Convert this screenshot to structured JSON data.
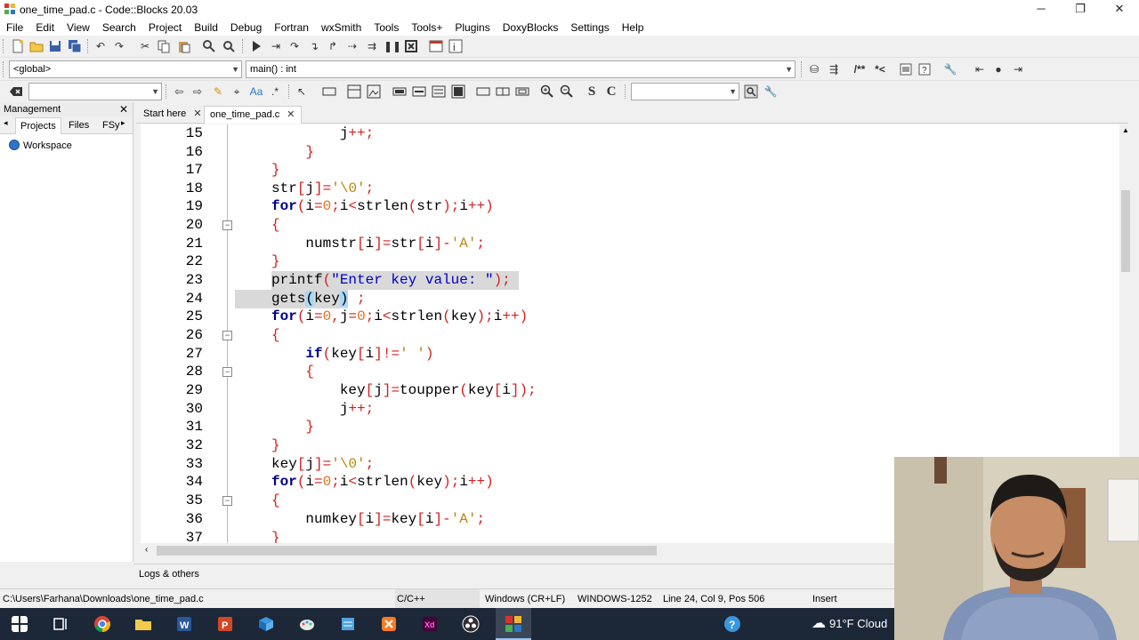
{
  "window": {
    "title": "one_time_pad.c - Code::Blocks 20.03",
    "minimize": "─",
    "restore": "❐",
    "close": "✕"
  },
  "menu": [
    "File",
    "Edit",
    "View",
    "Search",
    "Project",
    "Build",
    "Debug",
    "Fortran",
    "wxSmith",
    "Tools",
    "Tools+",
    "Plugins",
    "DoxyBlocks",
    "Settings",
    "Help"
  ],
  "code_toolbar": {
    "scope": "<global>",
    "function": "main() : int",
    "search": "",
    "doc_search": ""
  },
  "toolbar_text": {
    "comment_block": "/**",
    "comment_line": "*<",
    "sym_s": "S",
    "sym_c": "C"
  },
  "management": {
    "title": "Management",
    "close": "✕",
    "tabs": [
      "Projects",
      "Files",
      "FSy"
    ],
    "tree_root": "Workspace"
  },
  "editor_tabs": [
    {
      "label": "Start here",
      "close": "✕"
    },
    {
      "label": "one_time_pad.c",
      "close": "✕"
    }
  ],
  "code_lines": [
    {
      "n": "15",
      "t": "            j++;"
    },
    {
      "n": "16",
      "t": "        }"
    },
    {
      "n": "17",
      "t": "    }"
    },
    {
      "n": "18",
      "t": "    str[j]='\\0';"
    },
    {
      "n": "19",
      "t": "    for(i=0;i<strlen(str);i++)"
    },
    {
      "n": "20",
      "t": "    {"
    },
    {
      "n": "21",
      "t": "        numstr[i]=str[i]-'A';"
    },
    {
      "n": "22",
      "t": "    }"
    },
    {
      "n": "23",
      "t": "    printf(\"Enter key value: \");"
    },
    {
      "n": "24",
      "t": "    gets(key);"
    },
    {
      "n": "25",
      "t": "    for(i=0,j=0;i<strlen(key);i++)"
    },
    {
      "n": "26",
      "t": "    {"
    },
    {
      "n": "27",
      "t": "        if(key[i]!=' ')"
    },
    {
      "n": "28",
      "t": "        {"
    },
    {
      "n": "29",
      "t": "            key[j]=toupper(key[i]);"
    },
    {
      "n": "30",
      "t": "            j++;"
    },
    {
      "n": "31",
      "t": "        }"
    },
    {
      "n": "32",
      "t": "    }"
    },
    {
      "n": "33",
      "t": "    key[j]='\\0';"
    },
    {
      "n": "34",
      "t": "    for(i=0;i<strlen(key);i++)"
    },
    {
      "n": "35",
      "t": "    {"
    },
    {
      "n": "36",
      "t": "        numkey[i]=key[i]-'A';"
    },
    {
      "n": "37",
      "t": "    }"
    }
  ],
  "logs_label": "Logs & others",
  "status": {
    "path": "C:\\Users\\Farhana\\Downloads\\one_time_pad.c",
    "language": "C/C++",
    "line_endings": "Windows (CR+LF)",
    "encoding": "WINDOWS-1252",
    "position": "Line 24, Col 9, Pos 506",
    "mode": "Insert"
  },
  "taskbar": {
    "weather": "91°F  Cloud"
  },
  "colors": {
    "keyword": "#00008b",
    "operator": "#d02020",
    "string": "#0000c8",
    "char": "#b8860b",
    "number": "#e07020",
    "highlight": "#d9d9d9",
    "taskbar": "#1c2738"
  }
}
